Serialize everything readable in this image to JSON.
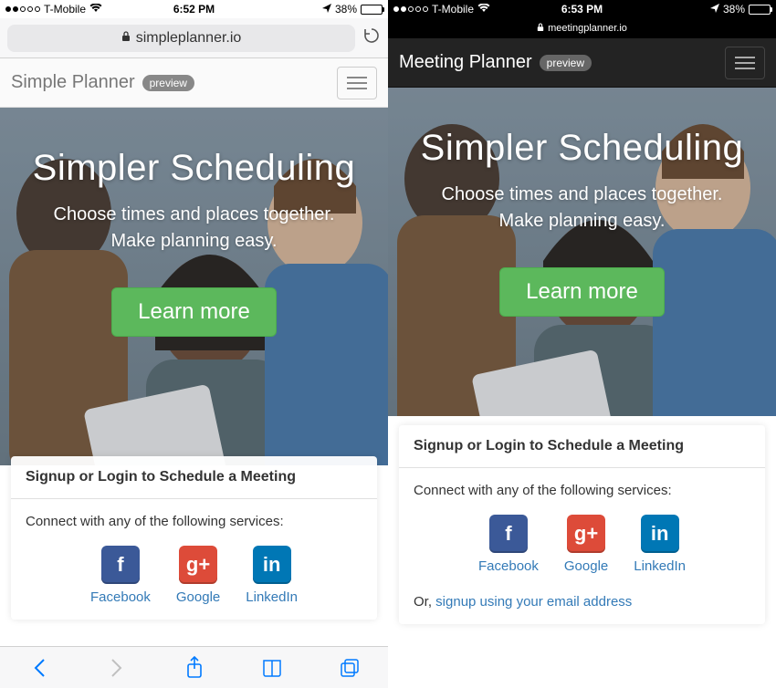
{
  "left": {
    "status": {
      "carrier": "T-Mobile",
      "time": "6:52 PM",
      "battery": "38%"
    },
    "url": "simpleplanner.io",
    "header": {
      "title": "Simple Planner",
      "badge": "preview"
    },
    "hero": {
      "headline": "Simpler Scheduling",
      "sub1": "Choose times and places together.",
      "sub2": "Make planning easy.",
      "cta": "Learn more"
    },
    "panel": {
      "title": "Signup or Login to Schedule a Meeting",
      "connect": "Connect with any of the following services:",
      "fb": "Facebook",
      "gp": "Google",
      "li": "LinkedIn"
    }
  },
  "right": {
    "status": {
      "carrier": "T-Mobile",
      "time": "6:53 PM",
      "battery": "38%"
    },
    "url": "meetingplanner.io",
    "header": {
      "title": "Meeting Planner",
      "badge": "preview"
    },
    "hero": {
      "headline": "Simpler Scheduling",
      "sub1": "Choose times and places together.",
      "sub2": "Make planning easy.",
      "cta": "Learn more"
    },
    "panel": {
      "title": "Signup or Login to Schedule a Meeting",
      "connect": "Connect with any of the following services:",
      "fb": "Facebook",
      "gp": "Google",
      "li": "LinkedIn",
      "or": "Or, ",
      "or_link": "signup using your email address"
    }
  }
}
